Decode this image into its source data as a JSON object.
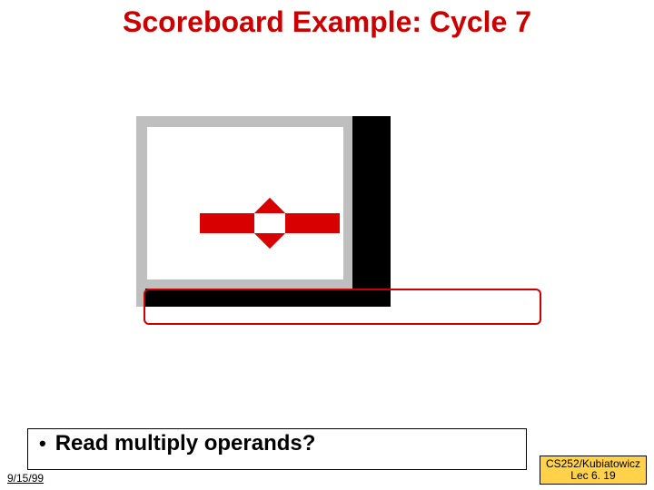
{
  "title": "Scoreboard Example: Cycle 7",
  "bullet": "Read multiply operands?",
  "footer": {
    "date": "9/15/99",
    "course": "CS252/Kubiatowicz",
    "lecture": "Lec 6. 19"
  },
  "icons": {
    "broken_image": "broken-image-icon"
  },
  "colors": {
    "accent_red": "#cc0000",
    "highlight_yellow": "#ffd24a"
  }
}
